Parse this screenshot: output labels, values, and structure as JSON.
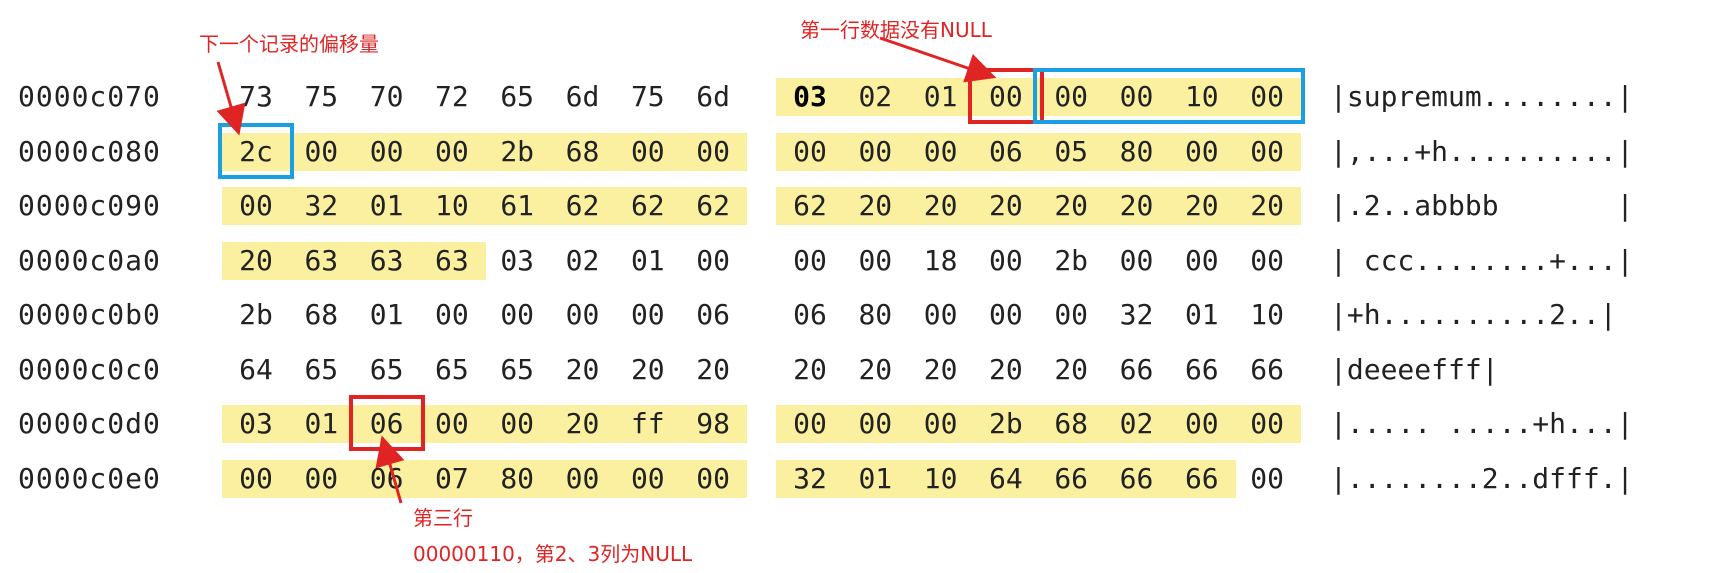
{
  "annotations": {
    "next_record_offset": "下一个记录的偏移量",
    "first_row_no_null": "第一行数据没有NULL",
    "third_row": "第三行",
    "third_row_detail": "00000110，第2、3列为NULL"
  },
  "colors": {
    "highlight": "#fbf0a0",
    "red_box": "#e02424",
    "blue_box": "#1aa0e0",
    "annotation_text": "#e02424"
  },
  "hex_dump": {
    "rows": [
      {
        "address": "0000c070",
        "bytes": [
          "73",
          "75",
          "70",
          "72",
          "65",
          "6d",
          "75",
          "6d",
          "03",
          "02",
          "01",
          "00",
          "00",
          "00",
          "10",
          "00"
        ],
        "ascii": "|supremum........|"
      },
      {
        "address": "0000c080",
        "bytes": [
          "2c",
          "00",
          "00",
          "00",
          "2b",
          "68",
          "00",
          "00",
          "00",
          "00",
          "00",
          "06",
          "05",
          "80",
          "00",
          "00"
        ],
        "ascii": "|,...+h..........|"
      },
      {
        "address": "0000c090",
        "bytes": [
          "00",
          "32",
          "01",
          "10",
          "61",
          "62",
          "62",
          "62",
          "62",
          "20",
          "20",
          "20",
          "20",
          "20",
          "20",
          "20"
        ],
        "ascii": "|.2..abbbb       |"
      },
      {
        "address": "0000c0a0",
        "bytes": [
          "20",
          "63",
          "63",
          "63",
          "03",
          "02",
          "01",
          "00",
          "00",
          "00",
          "18",
          "00",
          "2b",
          "00",
          "00",
          "00"
        ],
        "ascii": "| ccc........+...|"
      },
      {
        "address": "0000c0b0",
        "bytes": [
          "2b",
          "68",
          "01",
          "00",
          "00",
          "00",
          "00",
          "06",
          "06",
          "80",
          "00",
          "00",
          "00",
          "32",
          "01",
          "10"
        ],
        "ascii": "|+h..........2..|"
      },
      {
        "address": "0000c0c0",
        "bytes": [
          "64",
          "65",
          "65",
          "65",
          "65",
          "20",
          "20",
          "20",
          "20",
          "20",
          "20",
          "20",
          "20",
          "66",
          "66",
          "66"
        ],
        "ascii": "|deeeefff|"
      },
      {
        "address": "0000c0d0",
        "bytes": [
          "03",
          "01",
          "06",
          "00",
          "00",
          "20",
          "ff",
          "98",
          "00",
          "00",
          "00",
          "2b",
          "68",
          "02",
          "00",
          "00"
        ],
        "ascii": "|..... .....+h...|"
      },
      {
        "address": "0000c0e0",
        "bytes": [
          "00",
          "00",
          "06",
          "07",
          "80",
          "00",
          "00",
          "00",
          "32",
          "01",
          "10",
          "64",
          "66",
          "66",
          "66",
          "00"
        ],
        "ascii": "|........2..dfff.|"
      }
    ],
    "bold_cells": [
      [
        0,
        8
      ]
    ],
    "highlighted_cells": [
      [
        1,
        0
      ],
      [
        1,
        1
      ],
      [
        1,
        2
      ],
      [
        1,
        3
      ],
      [
        1,
        4
      ],
      [
        1,
        5
      ],
      [
        1,
        6
      ],
      [
        1,
        7
      ],
      [
        1,
        8
      ],
      [
        1,
        9
      ],
      [
        1,
        10
      ],
      [
        1,
        11
      ],
      [
        1,
        12
      ],
      [
        1,
        13
      ],
      [
        1,
        14
      ],
      [
        1,
        15
      ],
      [
        2,
        0
      ],
      [
        2,
        1
      ],
      [
        2,
        2
      ],
      [
        2,
        3
      ],
      [
        2,
        4
      ],
      [
        2,
        5
      ],
      [
        2,
        6
      ],
      [
        2,
        7
      ],
      [
        2,
        8
      ],
      [
        2,
        9
      ],
      [
        2,
        10
      ],
      [
        2,
        11
      ],
      [
        2,
        12
      ],
      [
        2,
        13
      ],
      [
        2,
        14
      ],
      [
        2,
        15
      ],
      [
        3,
        0
      ],
      [
        3,
        1
      ],
      [
        3,
        2
      ],
      [
        3,
        3
      ],
      [
        0,
        8
      ],
      [
        0,
        9
      ],
      [
        0,
        10
      ],
      [
        0,
        11
      ],
      [
        0,
        12
      ],
      [
        0,
        13
      ],
      [
        0,
        14
      ],
      [
        0,
        15
      ],
      [
        6,
        0
      ],
      [
        6,
        1
      ],
      [
        6,
        2
      ],
      [
        6,
        3
      ],
      [
        6,
        4
      ],
      [
        6,
        5
      ],
      [
        6,
        6
      ],
      [
        6,
        7
      ],
      [
        6,
        8
      ],
      [
        6,
        9
      ],
      [
        6,
        10
      ],
      [
        6,
        11
      ],
      [
        6,
        12
      ],
      [
        6,
        13
      ],
      [
        6,
        14
      ],
      [
        6,
        15
      ],
      [
        7,
        0
      ],
      [
        7,
        1
      ],
      [
        7,
        2
      ],
      [
        7,
        3
      ],
      [
        7,
        4
      ],
      [
        7,
        5
      ],
      [
        7,
        6
      ],
      [
        7,
        7
      ],
      [
        7,
        8
      ],
      [
        7,
        9
      ],
      [
        7,
        10
      ],
      [
        7,
        11
      ],
      [
        7,
        12
      ],
      [
        7,
        13
      ],
      [
        7,
        14
      ]
    ],
    "red_boxed_cells": [
      [
        0,
        11
      ],
      [
        6,
        2
      ]
    ],
    "blue_boxed_ranges": [
      [
        0,
        12,
        15
      ],
      [
        1,
        0,
        0
      ]
    ]
  }
}
